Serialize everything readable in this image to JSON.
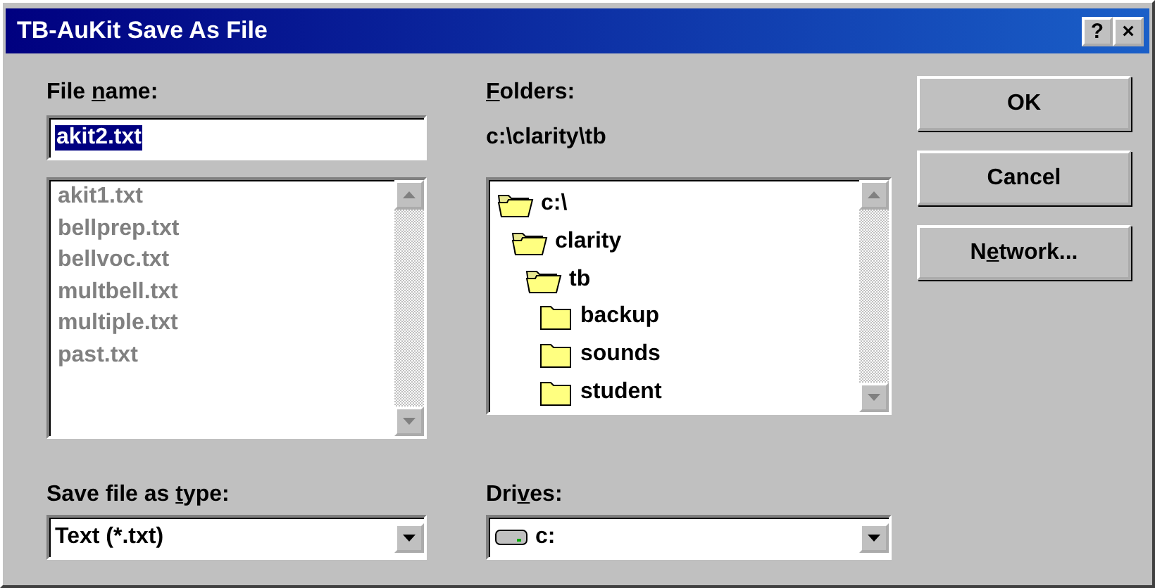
{
  "window": {
    "title": "TB-AuKit Save As File",
    "title_buttons": [
      "?",
      "×"
    ]
  },
  "file_name": {
    "label": {
      "before": "File ",
      "key": "n",
      "after": "ame:"
    },
    "value": "akit2.txt",
    "selected": true
  },
  "files": [
    {
      "name": "akit1.txt",
      "disabled": true
    },
    {
      "name": "bellprep.txt",
      "disabled": true
    },
    {
      "name": "bellvoc.txt",
      "disabled": true
    },
    {
      "name": "multbell.txt",
      "disabled": true
    },
    {
      "name": "multiple.txt",
      "disabled": true
    },
    {
      "name": "past.txt",
      "disabled": true
    }
  ],
  "folders": {
    "label": {
      "key": "F",
      "after": "olders:"
    },
    "path": "c:\\clarity\\tb",
    "tree": [
      {
        "name": "c:\\",
        "open": true,
        "children": [
          {
            "name": "clarity",
            "open": true,
            "children": [
              {
                "name": "tb",
                "open": true,
                "children": [
                  {
                    "name": "backup",
                    "open": false
                  },
                  {
                    "name": "sounds",
                    "open": false
                  },
                  {
                    "name": "student",
                    "open": false
                  }
                ]
              }
            ]
          }
        ]
      }
    ]
  },
  "save_type": {
    "label": {
      "before": "Save file as ",
      "key": "t",
      "after": "ype:"
    },
    "value": "Text (*.txt)"
  },
  "drives": {
    "label": {
      "before": "Dri",
      "key": "v",
      "after": "es:"
    },
    "value": "c:"
  },
  "buttons": [
    {
      "label": {
        "before": "OK"
      }
    },
    {
      "label": {
        "before": "Cancel"
      }
    },
    {
      "label": {
        "before": "N",
        "key": "e",
        "after": "twork..."
      }
    }
  ]
}
